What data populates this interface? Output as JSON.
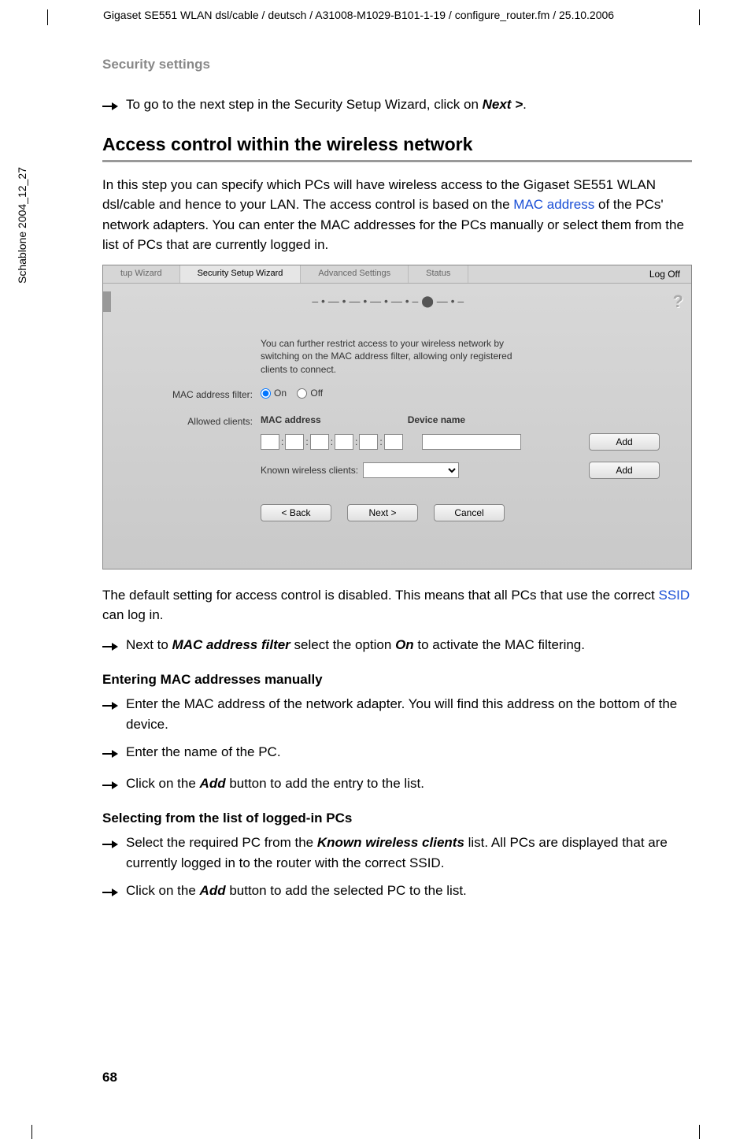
{
  "header": "Gigaset SE551 WLAN dsl/cable / deutsch / A31008-M1029-B101-1-19 / configure_router.fm / 25.10.2006",
  "side_text": "Schablone 2004_12_27",
  "section_title": "Security settings",
  "intro_arrow": {
    "pre": "To go to the next step in the Security Setup Wizard, click on ",
    "bold": "Next >",
    "post": "."
  },
  "main_heading": "Access control within the wireless network",
  "paragraph1": {
    "t1": "In this step you can specify which PCs will have wireless access to the Gigaset SE551 WLAN dsl/cable and hence to your LAN. The access control is based on the ",
    "link": "MAC address",
    "t2": " of the PCs' network adapters. You can enter the MAC addresses for the PCs manually or select them from the list of PCs that are currently logged in."
  },
  "router": {
    "tabs": [
      "tup Wizard",
      "Security Setup Wizard",
      "Advanced Settings",
      "Status"
    ],
    "logoff": "Log Off",
    "help": "?",
    "info_text": "You can further restrict access to your wireless network by switching on the MAC address filter, allowing only registered clients to connect.",
    "mac_filter_label": "MAC address filter:",
    "on": "On",
    "off": "Off",
    "allowed_label": "Allowed clients:",
    "mac_head": "MAC address",
    "dev_head": "Device name",
    "known_label": "Known wireless clients:",
    "add": "Add",
    "back": "< Back",
    "next": "Next >",
    "cancel": "Cancel"
  },
  "paragraph2": {
    "t1": "The default setting for access control is disabled. This means that all PCs that use the correct ",
    "link": "SSID",
    "t2": " can log in."
  },
  "filter_arrow": {
    "pre": "Next to ",
    "b1": "MAC address filter",
    "mid": " select the option ",
    "b2": "On",
    "post": " to activate the MAC filtering."
  },
  "sub1": "Entering MAC addresses manually",
  "arrows1": [
    "Enter the MAC address of the network adapter. You will find this address on the bottom of the device.",
    "Enter the name of the PC."
  ],
  "arrow1_add": {
    "pre": "Click on the ",
    "bold": "Add",
    "post": " button to add the entry to the list."
  },
  "sub2": "Selecting from the list of logged-in PCs",
  "arrow2_select": {
    "pre": "Select the required PC from the ",
    "bold": "Known wireless clients",
    "post": " list. All PCs are displayed that are currently logged in to the router with the correct SSID."
  },
  "arrow2_add": {
    "pre": "Click on the ",
    "bold": "Add",
    "post": " button to add the selected PC to the list."
  },
  "page_number": "68"
}
